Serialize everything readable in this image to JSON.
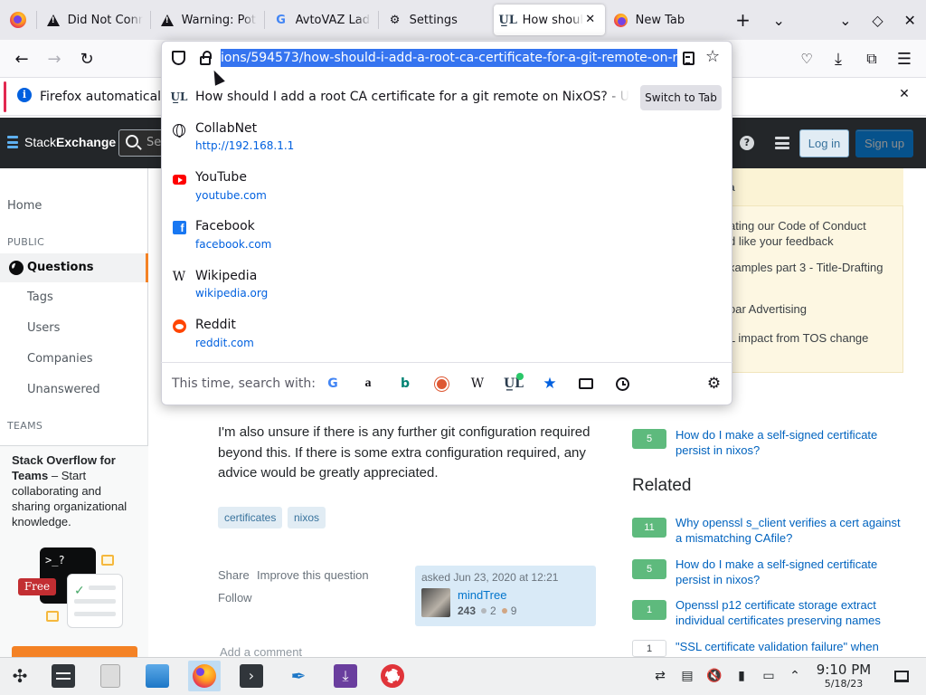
{
  "browser": {
    "tabs": [
      {
        "label": "Did Not Conn",
        "icon": "warning-icon"
      },
      {
        "label": "Warning: Pot",
        "icon": "warning-icon"
      },
      {
        "label": "AvtoVAZ Lada",
        "icon": "google-icon"
      },
      {
        "label": "Settings",
        "icon": "gear-icon"
      },
      {
        "label": "How should",
        "icon": "unix-linux-icon",
        "active": true
      },
      {
        "label": "New Tab",
        "icon": "firefox-icon"
      }
    ],
    "new_tab_symbol": "+",
    "url_full": "ions/594573/how-should-i-add-a-root-ca-certificate-for-a-git-remote-on-nixos",
    "notice_text": "Firefox automatically",
    "notice_accent": "#e22850"
  },
  "dropdown": {
    "suggestions": [
      {
        "title": "How should I add a root CA certificate for a git remote on NixOS? - Unix & Linux Stack Exchange",
        "url": "",
        "icon": "unix-linux-icon",
        "action": "Switch to Tab"
      },
      {
        "title": "CollabNet",
        "url": "http://192.168.1.1",
        "icon": "globe-icon"
      },
      {
        "title": "YouTube",
        "url": "youtube.com",
        "icon": "youtube-icon"
      },
      {
        "title": "Facebook",
        "url": "facebook.com",
        "icon": "facebook-icon"
      },
      {
        "title": "Wikipedia",
        "url": "wikipedia.org",
        "icon": "wikipedia-icon"
      },
      {
        "title": "Reddit",
        "url": "reddit.com",
        "icon": "reddit-icon"
      }
    ],
    "search_with_label": "This time, search with:",
    "engines": [
      "google-icon",
      "amazon-icon",
      "bing-icon",
      "duckduckgo-icon",
      "wikipedia-icon",
      "unix-linux-add-icon",
      "bookmarks-icon",
      "tabs-icon",
      "history-icon"
    ]
  },
  "site": {
    "logo_a": "Stack",
    "logo_b": "Exchange",
    "search_placeholder": "Se",
    "login": "Log in",
    "signup": "Sign up",
    "accent": "#f48225"
  },
  "leftnav": {
    "home": "Home",
    "public_heading": "PUBLIC",
    "questions": "Questions",
    "tags": "Tags",
    "users": "Users",
    "companies": "Companies",
    "unanswered": "Unanswered",
    "teams_heading": "TEAMS",
    "teams_title": "Stack Overflow for Teams",
    "teams_body": " – Start collaborating and sharing organizational knowledge.",
    "teams_prompt": ">_?",
    "free_badge": "Free"
  },
  "question": {
    "body": "I'm also unsure if there is any further git configuration required beyond this. If there is some extra configuration required, any advice would be greatly appreciated.",
    "tags": [
      "certificates",
      "nixos"
    ],
    "share": "Share",
    "improve": "Improve this question",
    "follow": "Follow",
    "asked": "asked Jun 23, 2020 at 12:21",
    "user": "mindTree",
    "rep": "243",
    "silver": "2",
    "bronze": "9",
    "add_comment": "Add a comment"
  },
  "sidebar": {
    "meta_heading": "a",
    "meta_items": [
      "ating our Code of Conduct\nd like your feedback",
      "xamples part 3 - Title-Drafting",
      "oar Advertising",
      "L impact from TOS change"
    ],
    "linked": [
      {
        "score": "5",
        "title": "How do I make a self-signed certificate persist in nixos?"
      }
    ],
    "related_heading": "Related",
    "related": [
      {
        "score": "11",
        "title": "Why openssl s_client verifies a cert against a mismatching CAfile?"
      },
      {
        "score": "5",
        "title": "How do I make a self-signed certificate persist in nixos?"
      },
      {
        "score": "1",
        "title": "Openssl p12 certificate storage extract individual certificates preserving names"
      },
      {
        "score": "1",
        "title": "\"SSL certificate validation failure\" when"
      }
    ]
  },
  "taskbar": {
    "time": "9:10 PM",
    "date": "5/18/23",
    "apps": [
      "application-launcher-icon",
      "system-settings-icon",
      "file-icon",
      "file-manager-icon",
      "firefox-icon",
      "terminal-icon",
      "text-editor-icon",
      "downloader-icon",
      "help-lifebuoy-icon"
    ]
  }
}
